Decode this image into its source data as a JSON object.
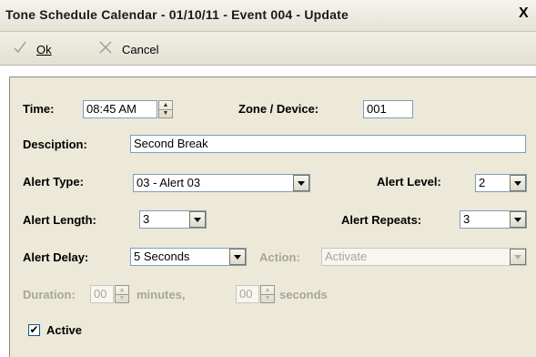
{
  "window": {
    "title": "Tone Schedule Calendar -  01/10/11 - Event 004 - Update",
    "close_glyph": "X"
  },
  "toolbar": {
    "ok_label": "Ok",
    "cancel_label": "Cancel"
  },
  "form": {
    "time_label": "Time:",
    "time_value": "08:45 AM",
    "zone_label": "Zone / Device:",
    "zone_value": "001",
    "description_label": "Desciption:",
    "description_value": "Second Break",
    "alert_type_label": "Alert Type:",
    "alert_type_value": "03 - Alert 03",
    "alert_level_label": "Alert Level:",
    "alert_level_value": "2",
    "alert_length_label": "Alert Length:",
    "alert_length_value": "3",
    "alert_repeats_label": "Alert Repeats:",
    "alert_repeats_value": "3",
    "alert_delay_label": "Alert Delay:",
    "alert_delay_value": "5 Seconds",
    "action_label": "Action:",
    "action_value": "Activate",
    "duration_label": "Duration:",
    "duration_minutes_value": "00",
    "minutes_label": "minutes,",
    "duration_seconds_value": "00",
    "seconds_label": "seconds",
    "active_label": "Active",
    "active_check": "✔"
  },
  "icons": {
    "ok": "check-icon",
    "cancel": "x-icon"
  },
  "colors": {
    "panel": "#ece9d8",
    "field_border": "#7f9db9",
    "disabled_text": "#a8a69a"
  }
}
